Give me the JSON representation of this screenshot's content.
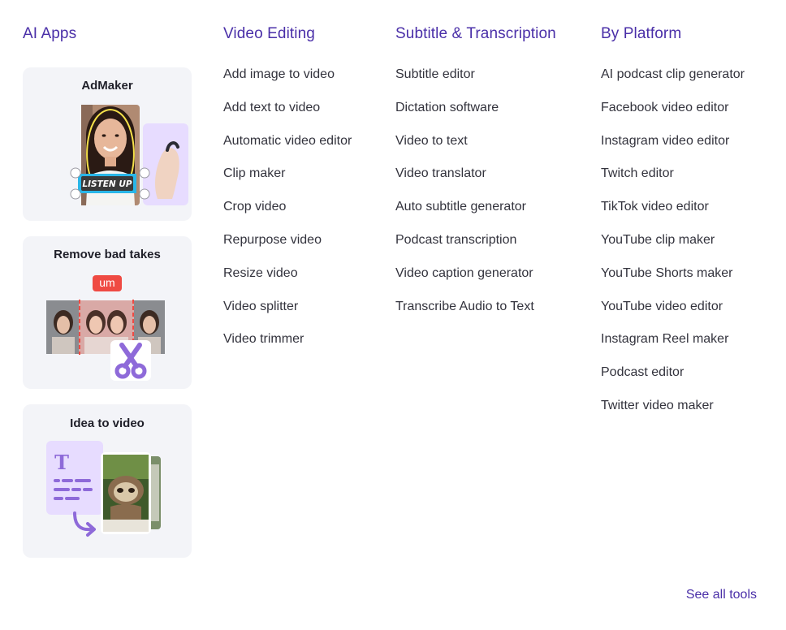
{
  "columns": {
    "ai_apps": {
      "title": "AI Apps"
    },
    "video_editing": {
      "title": "Video Editing",
      "items": [
        "Add image to video",
        "Add text to video",
        "Automatic video editor",
        "Clip maker",
        "Crop video",
        "Repurpose video",
        "Resize video",
        "Video splitter",
        "Video trimmer"
      ]
    },
    "subtitle": {
      "title": "Subtitle & Transcription",
      "items": [
        "Subtitle editor",
        "Dictation software",
        "Video to text",
        "Video translator",
        "Auto subtitle generator",
        "Podcast transcription",
        "Video caption generator",
        "Transcribe Audio to Text"
      ]
    },
    "platform": {
      "title": "By Platform",
      "items": [
        "AI podcast clip generator",
        "Facebook video editor",
        "Instagram video editor",
        "Twitch editor",
        "TikTok video editor",
        "YouTube clip maker",
        "YouTube Shorts maker",
        "YouTube video editor",
        "Instagram Reel maker",
        "Podcast editor",
        "Twitter video maker"
      ]
    }
  },
  "cards": {
    "admaker": {
      "title": "AdMaker",
      "sticker": "LISTEN UP"
    },
    "bad_takes": {
      "title": "Remove bad takes",
      "badge": "um"
    },
    "idea": {
      "title": "Idea to video",
      "letter": "T"
    }
  },
  "footer": {
    "see_all": "See all tools"
  },
  "colors": {
    "accent": "#4a2fa8",
    "card_bg": "#f3f4f8",
    "lavender": "#e7dcff",
    "purple_icon": "#8e6ad9",
    "badge_red": "#ef4a43"
  }
}
